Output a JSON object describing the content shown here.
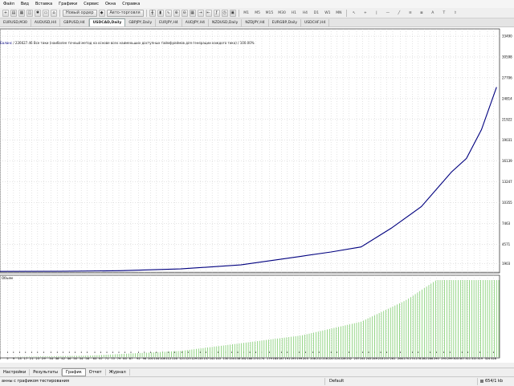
{
  "menu": [
    "Файл",
    "Вид",
    "Вставка",
    "Графики",
    "Сервис",
    "Окна",
    "Справка"
  ],
  "toolbar": {
    "new_order": "Новый ордер",
    "autotrading": "Авто-торговля",
    "timeframes": [
      "M1",
      "M5",
      "M15",
      "M30",
      "H1",
      "H4",
      "D1",
      "W1",
      "MN"
    ]
  },
  "symbol_tabs": [
    "EURUSD,M30",
    "AUDUSD,H4",
    "GBPUSD,H4",
    "USDCAD,Daily",
    "GBPJPY,Daily",
    "EURJPY,H4",
    "AUDJPY,H4",
    "NZDUSD,Daily",
    "NZDJPY,H4",
    "EURGBP,Daily",
    "USDCHF,H4"
  ],
  "active_symbol_tab": 3,
  "chart_info": {
    "balance_label": "Баланс",
    "balance_value": "/ 226627.46",
    "description": "Все тики (наиболее точный метод на основе всех наименьших доступных таймфреймов для генерации каждого тика) / 100.00%"
  },
  "volume_label": "Объем",
  "bottom_tabs": [
    "Настройки",
    "Результаты",
    "График",
    "Отчет",
    "Журнал"
  ],
  "active_bottom_tab": 2,
  "status": {
    "left": "анны с графиком тестирования",
    "profile": "Default",
    "size": "654/1 kb"
  },
  "colors": {
    "balance_line": "#00007f",
    "volume_bars": "#7ccc6b",
    "grid": "#c8c8c8"
  },
  "chart_data": {
    "type": "line",
    "title": "",
    "xlabel": "",
    "ylabel": "",
    "x_ticks": [
      0,
      5,
      9,
      13,
      17,
      21,
      25,
      29,
      34,
      38,
      42,
      46,
      50,
      54,
      58,
      63,
      67,
      71,
      75,
      79,
      83,
      87,
      92,
      96,
      100,
      104,
      108,
      112,
      116,
      121,
      125,
      129,
      133,
      137,
      141,
      145,
      150,
      154,
      158,
      162,
      166,
      170,
      174,
      179,
      183,
      187,
      191,
      195,
      199,
      203,
      208,
      212,
      216,
      220,
      224,
      228,
      232,
      237,
      241,
      245,
      249,
      253,
      257,
      261,
      266,
      270,
      274,
      278,
      282,
      286,
      290,
      295,
      299,
      303,
      307,
      311,
      315,
      319,
      324,
      328
    ],
    "y_ticks": [
      1903,
      4571,
      7463,
      10355,
      13247,
      16139,
      19031,
      21922,
      24814,
      27706,
      30598,
      33490
    ],
    "ylim": [
      600,
      34500
    ],
    "xlim": [
      0,
      332
    ],
    "series": [
      {
        "x": [
          0,
          40,
          80,
          120,
          160,
          200,
          220,
          240,
          260,
          280,
          300,
          310,
          320,
          330
        ],
        "y": [
          800,
          820,
          900,
          1150,
          1700,
          2900,
          3500,
          4200,
          6800,
          9800,
          14600,
          16500,
          20500,
          26400
        ]
      }
    ],
    "volume": {
      "label": "Объем",
      "x": [
        0,
        60,
        120,
        160,
        200,
        240,
        270,
        290,
        300,
        330
      ],
      "levels": [
        0.0,
        0.02,
        0.08,
        0.18,
        0.28,
        0.46,
        0.74,
        1.0,
        1.0,
        1.0
      ]
    }
  }
}
